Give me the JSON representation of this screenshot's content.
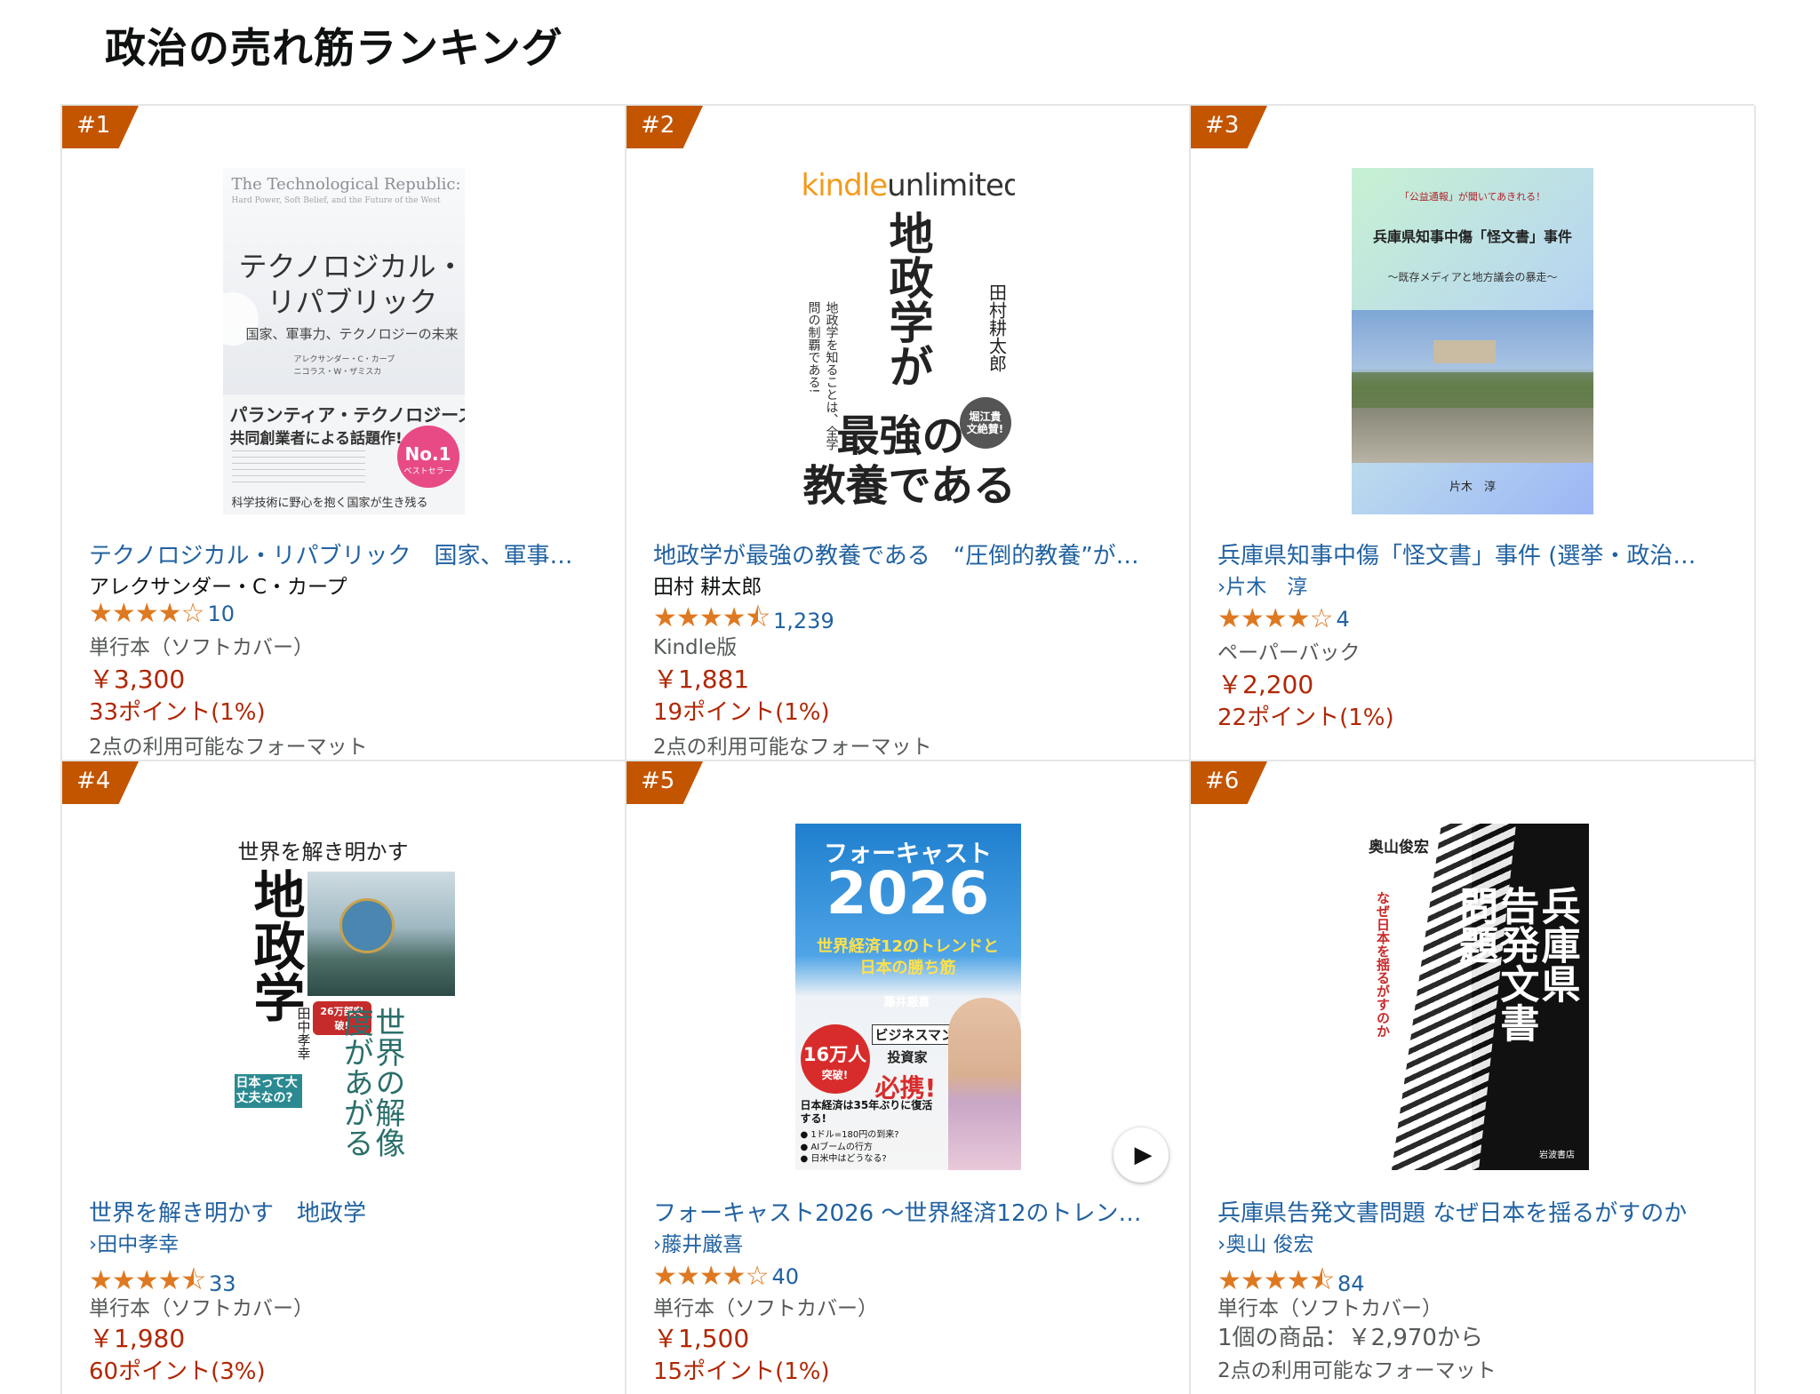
{
  "page_title": "政治の売れ筋ランキング",
  "colors": {
    "badge": "#c45500",
    "link": "#2162a1",
    "price": "#b12704",
    "star": "#de7921"
  },
  "products": [
    {
      "rank": "#1",
      "title": "テクノロジカル・リパブリック　国家、軍事…",
      "author": "アレクサンダー・C・カープ",
      "author_is_link": false,
      "stars": "★★★★☆",
      "rating_count": "10",
      "format": "単行本（ソフトカバー）",
      "price": "￥3,300",
      "points": "33ポイント(1%)",
      "formats_available": "2点の利用可能なフォーマット",
      "cover": {
        "line1": "The Technological Republic:",
        "line2": "Hard Power, Soft Belief, and the Future of the West",
        "jp_title_a": "テクノロジカル・",
        "jp_title_b": "リパブリック",
        "jp_subtitle": "国家、軍事力、テクノロジーの未来",
        "authors_a": "アレクサンダー・C・カープ",
        "authors_b": "ニコラス・W・ザミスカ",
        "band_a": "パランティア・テクノロジーズ",
        "band_b": "共同創業者による話題作!",
        "seal_no": "No.1",
        "seal_label": "ベストセラー",
        "tagline": "科学技術に野心を抱く国家が生き残る"
      }
    },
    {
      "rank": "#2",
      "title": "地政学が最強の教養である　“圧倒的教養”が…",
      "author": "田村 耕太郎",
      "author_is_link": false,
      "stars": "★★★★⯪",
      "rating_count": "1,239",
      "format": "Kindle版",
      "price": "￥1,881",
      "points": "19ポイント(1%)",
      "formats_available": "2点の利用可能なフォーマット",
      "cover": {
        "logo_a": "kindle",
        "logo_b": "unlimited",
        "big_a": "地政学が",
        "big_b": "最強の",
        "big_c": "教養である",
        "author_vertical": "田村耕太郎",
        "side_text": "地政学を知ることは、全学問の制覇である!",
        "seal": "堀江貴文絶賛!"
      }
    },
    {
      "rank": "#3",
      "title": "兵庫県知事中傷「怪文書」事件 (選挙・政治…",
      "author": "片木　淳",
      "author_is_link": true,
      "stars": "★★★★☆",
      "rating_count": "4",
      "format": "ペーパーバック",
      "price": "￥2,200",
      "points": "22ポイント(1%)",
      "formats_available": "",
      "cover": {
        "top_note": "「公益通報」が聞いてあきれる！",
        "main": "兵庫県知事中傷「怪文書」事件",
        "sub": "～既存メディアと地方議会の暴走～",
        "author": "片木　淳"
      }
    },
    {
      "rank": "#4",
      "title": "世界を解き明かす　地政学",
      "author": "田中孝幸",
      "author_is_link": true,
      "stars": "★★★★⯪",
      "rating_count": "33",
      "format": "単行本（ソフトカバー）",
      "price": "￥1,980",
      "points": "60ポイント(3%)",
      "formats_available": "",
      "cover": {
        "top": "世界を解き明かす",
        "big": "地政学",
        "author_v": "田中孝幸",
        "side": "世界の解像度があがる",
        "badge": "26万部突破!",
        "tag": "日本って大丈夫なの?"
      }
    },
    {
      "rank": "#5",
      "title": "フォーキャスト2026 〜世界経済12のトレン…",
      "author": "藤井厳喜",
      "author_is_link": true,
      "stars": "★★★★☆",
      "rating_count": "40",
      "format": "単行本（ソフトカバー）",
      "price": "￥1,500",
      "points": "15ポイント(1%)",
      "formats_available": "",
      "cover": {
        "title": "フォーキャスト",
        "year": "2026",
        "sub_a": "世界経済12のトレンドと",
        "sub_b": "日本の勝ち筋",
        "author": "藤井厳喜",
        "badge_big": "16万人",
        "badge_small": "突破!",
        "role_a": "ビジネスマン",
        "role_b": "投資家",
        "must": "必携!",
        "bullet_head": "日本経済は35年ぶりに復活する!",
        "bullets": [
          "1ドル=180円の到来?",
          "AIブームの行方",
          "日米中はどうなる?"
        ]
      }
    },
    {
      "rank": "#6",
      "title": "兵庫県告発文書問題 なぜ日本を揺るがすのか",
      "author": "奥山 俊宏",
      "author_is_link": true,
      "stars": "★★★★⯪",
      "rating_count": "84",
      "format": "単行本（ソフトカバー）",
      "price": "1個の商品：￥2,970から",
      "price_plain": true,
      "points": "",
      "formats_available": "2点の利用可能なフォーマット",
      "cover": {
        "author": "奥山俊宏",
        "title_a": "兵庫県",
        "title_b": "告発文書",
        "title_c": "問題",
        "sub": "なぜ日本を揺るがすのか",
        "publisher": "岩波書店"
      }
    }
  ]
}
